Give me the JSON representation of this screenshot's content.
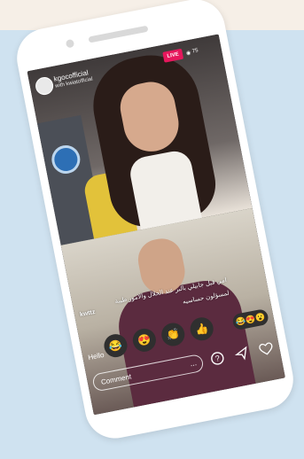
{
  "stream": {
    "username": "kgocofficial",
    "sublabel": "with kwiatofficial",
    "live_label": "LIVE",
    "viewer_count": "75"
  },
  "comment": {
    "name": "kwttz",
    "arabic_line1": "امي قبل جابيلي بالبر عند الحلال والامور طيبة",
    "arabic_line2": "لمسؤلون حساسيه"
  },
  "emojis": [
    "😂",
    "😍",
    "👏",
    "👍"
  ],
  "emoji_pill": "😂😍😮",
  "input": {
    "typed": "Hello",
    "comment_placeholder": "Comment",
    "more_label": "..."
  },
  "icons": {
    "viewer": "eye-icon",
    "question": "question-icon",
    "send": "send-icon",
    "like": "heart-icon"
  },
  "colors": {
    "live_badge": "#e6175c",
    "background_blue": "#cfe2f0"
  }
}
